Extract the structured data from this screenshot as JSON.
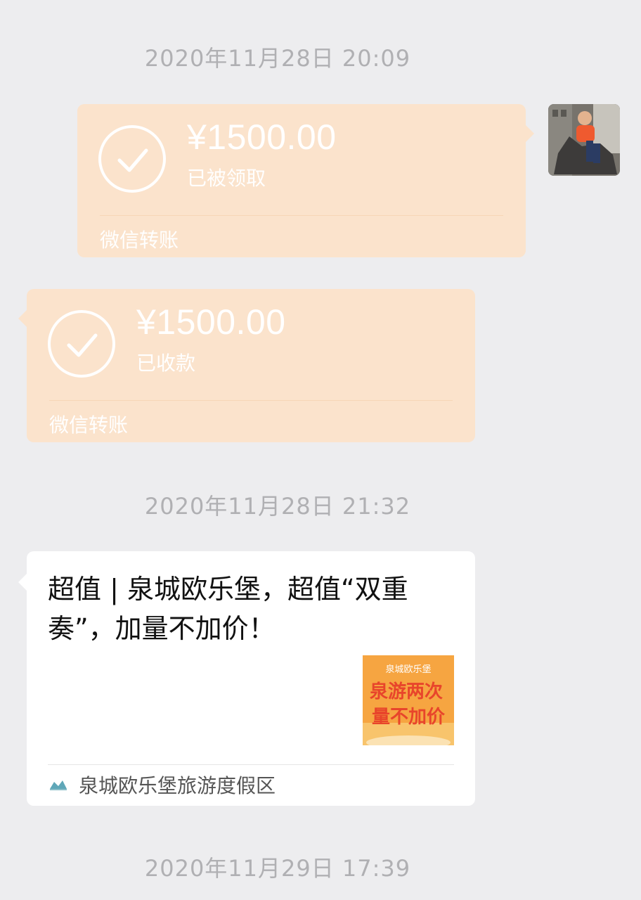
{
  "timestamps": {
    "first": "2020年11月28日 20:09",
    "second": "2020年11月28日 21:32",
    "third": "2020年11月29日 17:39"
  },
  "transfer_sent": {
    "amount": "¥1500.00",
    "status": "已被领取",
    "brand": "微信转账",
    "icon": "check-circle-icon"
  },
  "transfer_received": {
    "amount": "¥1500.00",
    "status": "已收款",
    "brand": "微信转账",
    "icon": "check-circle-icon"
  },
  "article": {
    "title": "超值 | 泉城欧乐堡，超值“双重奏”，加量不加价！",
    "thumbnail_text": {
      "top": "泉城欧乐堡",
      "middle": "泉游两次",
      "bottom": "量不加价"
    },
    "source_name": "泉城欧乐堡旅游度假区"
  },
  "colors": {
    "background": "#ededef",
    "transfer_bubble": "#fbe3cc",
    "article_bubble": "#ffffff",
    "timestamp_text": "#b0b0b3",
    "thumbnail_orange": "#f6a541"
  }
}
